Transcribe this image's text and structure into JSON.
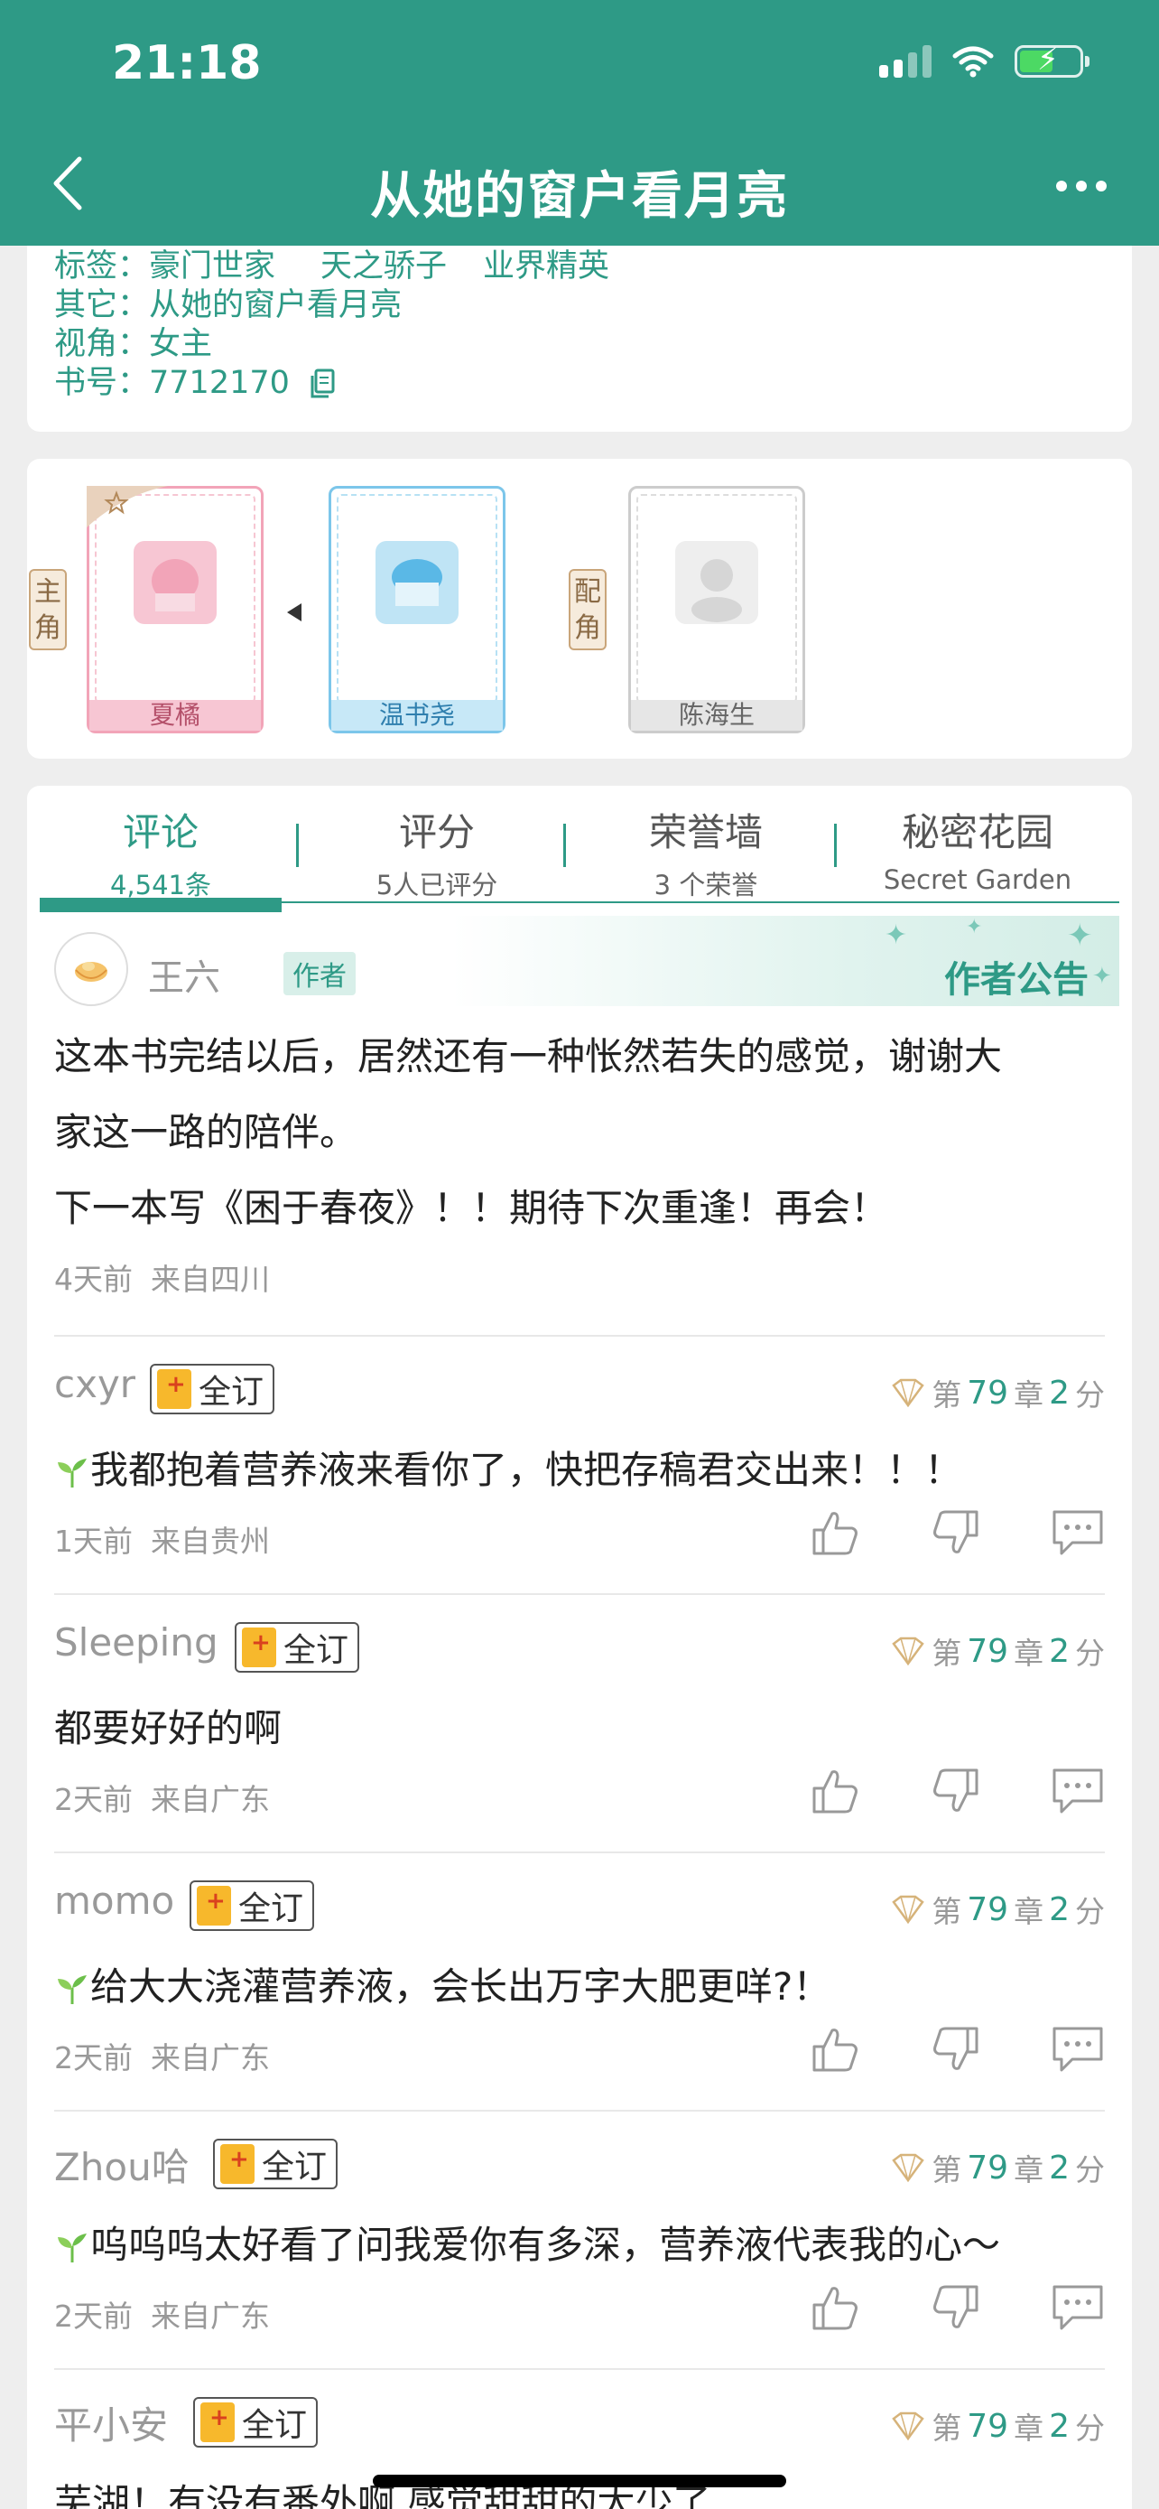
{
  "status_bar": {
    "time": "21:18"
  },
  "nav": {
    "title": "从她的窗户看月亮"
  },
  "info": {
    "tags_label": "标签：",
    "tags": [
      "豪门世家",
      "天之骄子",
      "业界精英"
    ],
    "other_label": "其它：",
    "other_value": "从她的窗户看月亮",
    "perspective_label": "视角：",
    "perspective_value": "女主",
    "book_no_label": "书号：",
    "book_no_value": "7712170"
  },
  "roles": {
    "main_tag": "主角",
    "support_tag": "配角",
    "characters": [
      {
        "name": "夏橘",
        "color": "#f2a4b8"
      },
      {
        "name": "温书尧",
        "color": "#7cc6ea"
      },
      {
        "name": "陈海生",
        "color": "#cccccc"
      }
    ]
  },
  "tabs": [
    {
      "title": "评论",
      "sub": "4,541条",
      "active": true
    },
    {
      "title": "评分",
      "sub": "5人已评分",
      "active": false
    },
    {
      "title": "荣誉墙",
      "sub": "3 个荣誉",
      "active": false
    },
    {
      "title": "秘密花园",
      "sub": "Secret Garden",
      "active": false
    }
  ],
  "author_notice": {
    "label": "作者公告",
    "name": "王六",
    "badge": "作者",
    "line1": "这本书完结以后，居然还有一种怅然若失的感觉，谢谢大",
    "line2": "家这一路的陪伴。",
    "line3": "下一本写《困于春夜》！！期待下次重逢！再会！",
    "time": "4天前",
    "location": "来自四川"
  },
  "comments": [
    {
      "user": "cxyr",
      "badge": "全订",
      "chapter_prefix": "第",
      "chapter": "79",
      "chapter_unit": "章",
      "score": "2",
      "score_unit": "分",
      "text": "我都抱着营养液来看你了，快把存稿君交出来！！！",
      "sprout": true,
      "time": "1天前",
      "location": "来自贵州"
    },
    {
      "user": "Sleeping",
      "badge": "全订",
      "chapter_prefix": "第",
      "chapter": "79",
      "chapter_unit": "章",
      "score": "2",
      "score_unit": "分",
      "text": "都要好好的啊",
      "sprout": false,
      "time": "2天前",
      "location": "来自广东"
    },
    {
      "user": "momo",
      "badge": "全订",
      "chapter_prefix": "第",
      "chapter": "79",
      "chapter_unit": "章",
      "score": "2",
      "score_unit": "分",
      "text": "给大大浇灌营养液，会长出万字大肥更咩?！",
      "sprout": true,
      "time": "2天前",
      "location": "来自广东"
    },
    {
      "user": "Zhou哈",
      "badge": "全订",
      "chapter_prefix": "第",
      "chapter": "79",
      "chapter_unit": "章",
      "score": "2",
      "score_unit": "分",
      "text": "呜呜呜太好看了问我爱你有多深，营养液代表我的心～",
      "sprout": true,
      "time": "2天前",
      "location": "来自广东"
    },
    {
      "user": "平小安",
      "badge": "全订",
      "chapter_prefix": "第",
      "chapter": "79",
      "chapter_unit": "章",
      "score": "2",
      "score_unit": "分",
      "text": "芜湖！有没有番外啊 感觉甜甜的太少了",
      "sprout": false,
      "time": "",
      "location": ""
    }
  ],
  "colors": {
    "accent": "#2e9a86",
    "badge_gold": "#f7b82c"
  }
}
